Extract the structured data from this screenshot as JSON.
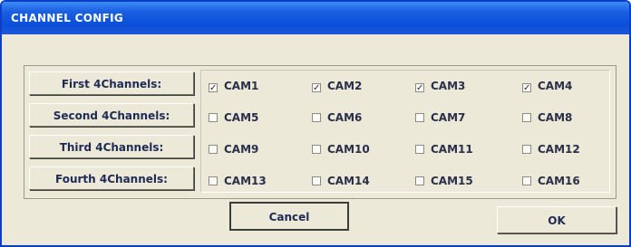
{
  "window": {
    "title": "CHANNEL CONFIG"
  },
  "rows": [
    {
      "label": "First 4Channels:",
      "cams": [
        {
          "name": "CAM1",
          "checked": true
        },
        {
          "name": "CAM2",
          "checked": true
        },
        {
          "name": "CAM3",
          "checked": true
        },
        {
          "name": "CAM4",
          "checked": true
        }
      ]
    },
    {
      "label": "Second 4Channels:",
      "cams": [
        {
          "name": "CAM5",
          "checked": false
        },
        {
          "name": "CAM6",
          "checked": false
        },
        {
          "name": "CAM7",
          "checked": false
        },
        {
          "name": "CAM8",
          "checked": false
        }
      ]
    },
    {
      "label": "Third 4Channels:",
      "cams": [
        {
          "name": "CAM9",
          "checked": false
        },
        {
          "name": "CAM10",
          "checked": false
        },
        {
          "name": "CAM11",
          "checked": false
        },
        {
          "name": "CAM12",
          "checked": false
        }
      ]
    },
    {
      "label": "Fourth 4Channels:",
      "cams": [
        {
          "name": "CAM13",
          "checked": false
        },
        {
          "name": "CAM14",
          "checked": false
        },
        {
          "name": "CAM15",
          "checked": false
        },
        {
          "name": "CAM16",
          "checked": false
        }
      ]
    }
  ],
  "buttons": {
    "cancel": "Cancel",
    "ok": "OK"
  },
  "colors": {
    "titlebar": "#0a4fd8",
    "face": "#ece9d8",
    "text": "#1f2a55"
  }
}
